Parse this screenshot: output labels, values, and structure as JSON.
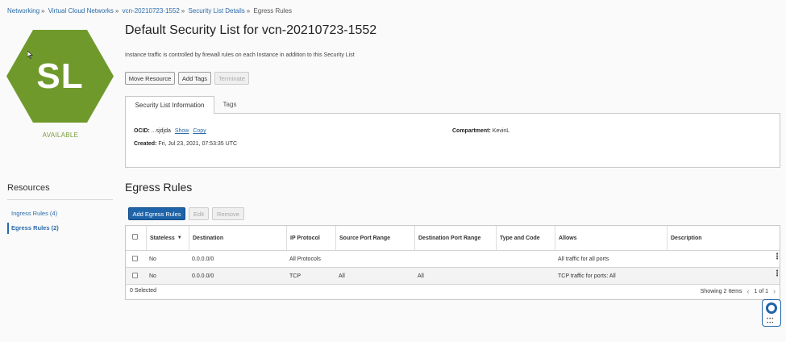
{
  "breadcrumb": {
    "items": [
      "Networking",
      "Virtual Cloud Networks",
      "vcn-20210723-1552",
      "Security List Details"
    ],
    "current": "Egress Rules",
    "separator": "»"
  },
  "resource_icon": {
    "initials": "SL",
    "color": "#6f9a2b",
    "status": "AVAILABLE"
  },
  "header": {
    "title": "Default Security List for vcn-20210723-1552",
    "subtitle": "Instance traffic is controlled by firewall rules on each Instance in addition to this Security List"
  },
  "actions": {
    "move_resource": "Move Resource",
    "add_tags": "Add Tags",
    "terminate": "Terminate"
  },
  "tabs": {
    "info": "Security List Information",
    "tags": "Tags"
  },
  "info": {
    "ocid_label": "OCID:",
    "ocid_value": "...sjdjda",
    "show": "Show",
    "copy": "Copy",
    "created_label": "Created:",
    "created_value": "Fri, Jul 23, 2021, 07:53:35 UTC",
    "compartment_label": "Compartment:",
    "compartment_value": "KevinL"
  },
  "resources": {
    "title": "Resources",
    "items": [
      {
        "label": "Ingress Rules (4)"
      },
      {
        "label": "Egress Rules (2)"
      }
    ]
  },
  "egress": {
    "title": "Egress Rules",
    "add_button": "Add Egress Rules",
    "edit_button": "Edit",
    "remove_button": "Remove",
    "columns": [
      "Stateless",
      "Destination",
      "IP Protocol",
      "Source Port Range",
      "Destination Port Range",
      "Type and Code",
      "Allows",
      "Description"
    ],
    "sort_icon": "▼",
    "rows": [
      {
        "stateless": "No",
        "destination": "0.0.0.0/0",
        "protocol": "All Protocols",
        "source_port": "",
        "dest_port": "",
        "type_code": "",
        "allows": "All traffic for all ports",
        "description": ""
      },
      {
        "stateless": "No",
        "destination": "0.0.0.0/0",
        "protocol": "TCP",
        "source_port": "All",
        "dest_port": "All",
        "type_code": "",
        "allows": "TCP traffic for ports: All",
        "description": ""
      }
    ],
    "selected": "0 Selected",
    "showing": "Showing 2 Items",
    "page": "1 of 1"
  },
  "colors": {
    "accent": "#1f64a8",
    "link": "#2a6aa8",
    "icon_green": "#6f9a2b"
  }
}
